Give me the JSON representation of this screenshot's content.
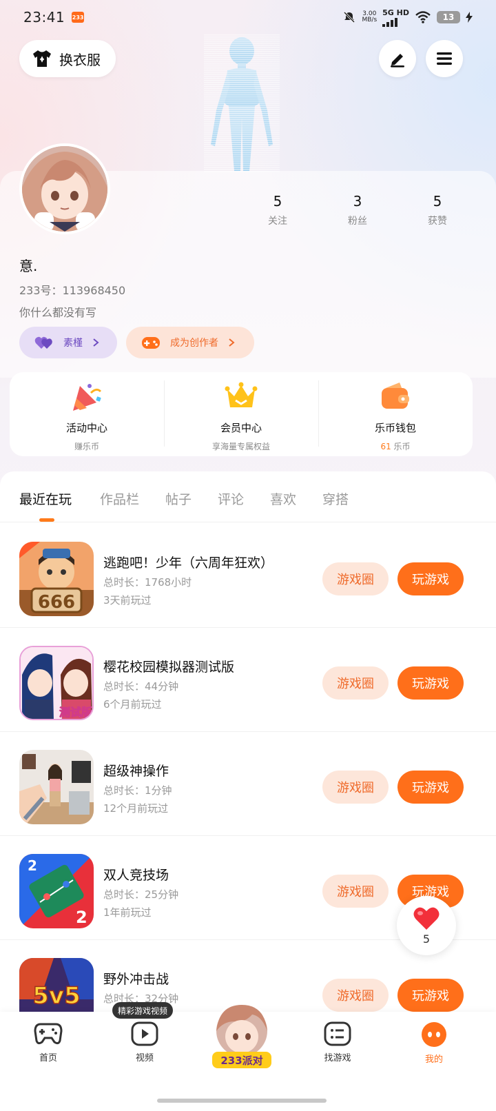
{
  "status_bar": {
    "time": "23:41",
    "app_badge": "233",
    "speed_value": "3.00",
    "speed_unit": "MB/s",
    "network": "5G HD",
    "battery": "13"
  },
  "header": {
    "outfit_label": "换衣服"
  },
  "profile": {
    "stats": [
      {
        "num": "5",
        "label": "关注"
      },
      {
        "num": "3",
        "label": "粉丝"
      },
      {
        "num": "5",
        "label": "获赞"
      }
    ],
    "nickname": "意.",
    "uid": "233号：113968450",
    "bio": "你什么都没有写",
    "chip_purple": "素槿",
    "chip_orange": "成为创作者"
  },
  "services": [
    {
      "title": "活动中心",
      "sub": "赚乐币"
    },
    {
      "title": "会员中心",
      "sub": "享海量专属权益"
    },
    {
      "title": "乐币钱包",
      "sub_value": "61",
      "sub_unit": "乐币"
    }
  ],
  "tabs": [
    "最近在玩",
    "作品栏",
    "帖子",
    "评论",
    "喜欢",
    "穿搭"
  ],
  "games": [
    {
      "name": "逃跑吧！少年（六周年狂欢）",
      "duration": "总时长：1768小时",
      "last": "3天前玩过"
    },
    {
      "name": "樱花校园模拟器测试版",
      "duration": "总时长：44分钟",
      "last": "6个月前玩过"
    },
    {
      "name": "超级神操作",
      "duration": "总时长：1分钟",
      "last": "12个月前玩过"
    },
    {
      "name": "双人竞技场",
      "duration": "总时长：25分钟",
      "last": "1年前玩过"
    },
    {
      "name": "野外冲击战",
      "duration": "总时长：32分钟",
      "last": ""
    }
  ],
  "game_buttons": {
    "circle": "游戏圈",
    "play": "玩游戏"
  },
  "icon_texts": {
    "game1": "666",
    "game2": "测试版",
    "game5": "5v5",
    "party": "233派对"
  },
  "like_count": "5",
  "nav": {
    "tooltip": "精彩游戏视频",
    "items": [
      "首页",
      "视频",
      "找游戏",
      "我的"
    ]
  },
  "colors": {
    "accent": "#ff6f1a",
    "accent_light": "#fde6da",
    "purple": "#6d4bc1"
  }
}
